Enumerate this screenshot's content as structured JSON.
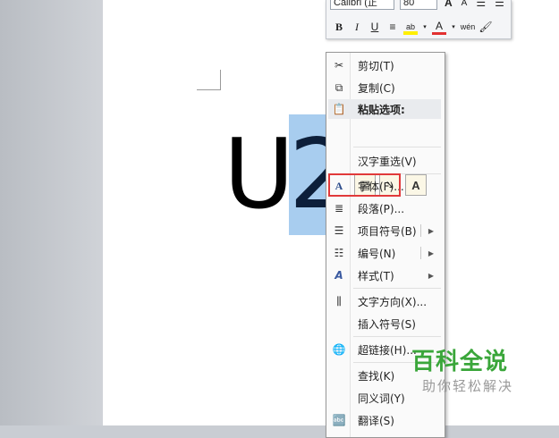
{
  "mini_toolbar": {
    "font_name": "Calibri (正",
    "font_size": "80",
    "row1_buttons": [
      "A",
      "A"
    ],
    "row2_buttons": [
      "B",
      "I",
      "U",
      "≡",
      "ab",
      "A",
      "wén"
    ]
  },
  "document": {
    "text_normal": "U",
    "text_selected": "2"
  },
  "context_menu": {
    "items": [
      {
        "label": "剪切(T)",
        "icon": "scissors-icon"
      },
      {
        "label": "复制(C)",
        "icon": "copy-icon"
      },
      {
        "label": "粘贴选项:",
        "icon": "paste-icon"
      },
      {
        "label": "汉字重选(V)"
      },
      {
        "label": "字体(F)...",
        "icon": "font-icon"
      },
      {
        "label": "段落(P)...",
        "icon": "paragraph-icon"
      },
      {
        "label": "项目符号(B)",
        "icon": "bullets-icon"
      },
      {
        "label": "编号(N)",
        "icon": "numbering-icon"
      },
      {
        "label": "样式(T)",
        "icon": "styles-icon"
      },
      {
        "label": "文字方向(X)...",
        "icon": "text-direction-icon"
      },
      {
        "label": "插入符号(S)"
      },
      {
        "label": "超链接(H)...",
        "icon": "hyperlink-icon"
      },
      {
        "label": "查找(K)"
      },
      {
        "label": "同义词(Y)"
      },
      {
        "label": "翻译(S)",
        "icon": "translate-icon"
      }
    ],
    "paste_options": [
      "keep-source-format",
      "merge-format",
      "A"
    ]
  },
  "watermark": {
    "title": "百科全说",
    "subtitle": "助你轻松解决"
  }
}
